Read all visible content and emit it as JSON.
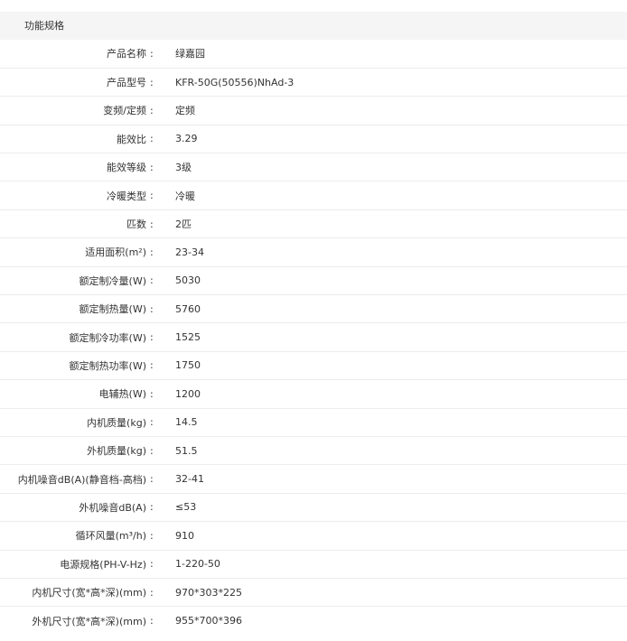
{
  "section_title": "功能规格",
  "separator": ":",
  "specs": [
    {
      "label": "产品名称",
      "value": "绿嘉园"
    },
    {
      "label": "产品型号",
      "value": "KFR-50G(50556)NhAd-3"
    },
    {
      "label": "变频/定频",
      "value": "定频"
    },
    {
      "label": "能效比",
      "value": "3.29"
    },
    {
      "label": "能效等级",
      "value": "3级"
    },
    {
      "label": "冷暖类型",
      "value": "冷暖"
    },
    {
      "label": "匹数",
      "value": "2匹"
    },
    {
      "label": "适用面积(m²)",
      "value": "23-34"
    },
    {
      "label": "额定制冷量(W)",
      "value": "5030"
    },
    {
      "label": "额定制热量(W)",
      "value": "5760"
    },
    {
      "label": "额定制冷功率(W)",
      "value": "1525"
    },
    {
      "label": "额定制热功率(W)",
      "value": "1750"
    },
    {
      "label": "电辅热(W)",
      "value": "1200"
    },
    {
      "label": "内机质量(kg)",
      "value": "14.5"
    },
    {
      "label": "外机质量(kg)",
      "value": "51.5"
    },
    {
      "label": "内机噪音dB(A)(静音档-高档)",
      "value": "32-41"
    },
    {
      "label": "外机噪音dB(A)",
      "value": "≤53"
    },
    {
      "label": "循环风量(m³/h)",
      "value": "910"
    },
    {
      "label": "电源规格(PH-V-Hz)",
      "value": "1-220-50"
    },
    {
      "label": "内机尺寸(宽*高*深)(mm)",
      "value": "970*303*225"
    },
    {
      "label": "外机尺寸(宽*高*深)(mm)",
      "value": "955*700*396"
    }
  ]
}
